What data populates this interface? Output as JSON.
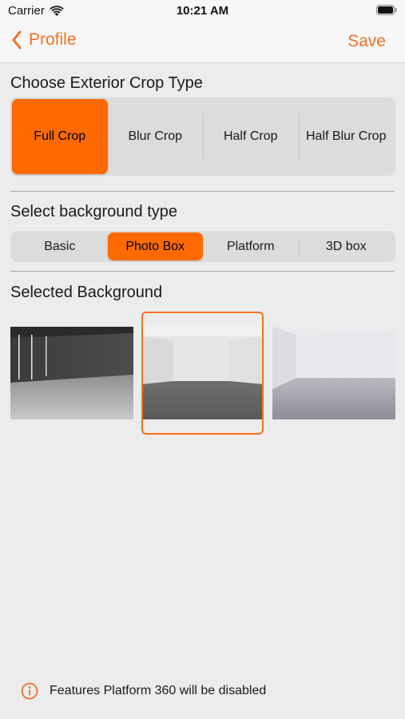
{
  "status_bar": {
    "carrier": "Carrier",
    "time": "10:21 AM"
  },
  "nav": {
    "back_label": "Profile",
    "save_label": "Save"
  },
  "crop_section": {
    "title": "Choose Exterior Crop Type",
    "options": [
      "Full Crop",
      "Blur Crop",
      "Half Crop",
      "Half Blur Crop"
    ],
    "selected": "Full Crop"
  },
  "background_type_section": {
    "title": "Select background type",
    "options": [
      "Basic",
      "Photo Box",
      "Platform",
      "3D box"
    ],
    "selected": "Photo Box"
  },
  "selected_background_section": {
    "title": "Selected Background",
    "thumbnails": [
      "dark-studio-room",
      "white-room-grey-floor",
      "white-room-light-floor"
    ],
    "selected_index": 1
  },
  "footer": {
    "note": "Features Platform 360 will be disabled",
    "icon": "info-icon"
  },
  "colors": {
    "accent": "#f37021",
    "selected_segment": "#ff6a00",
    "background": "#ececec"
  }
}
